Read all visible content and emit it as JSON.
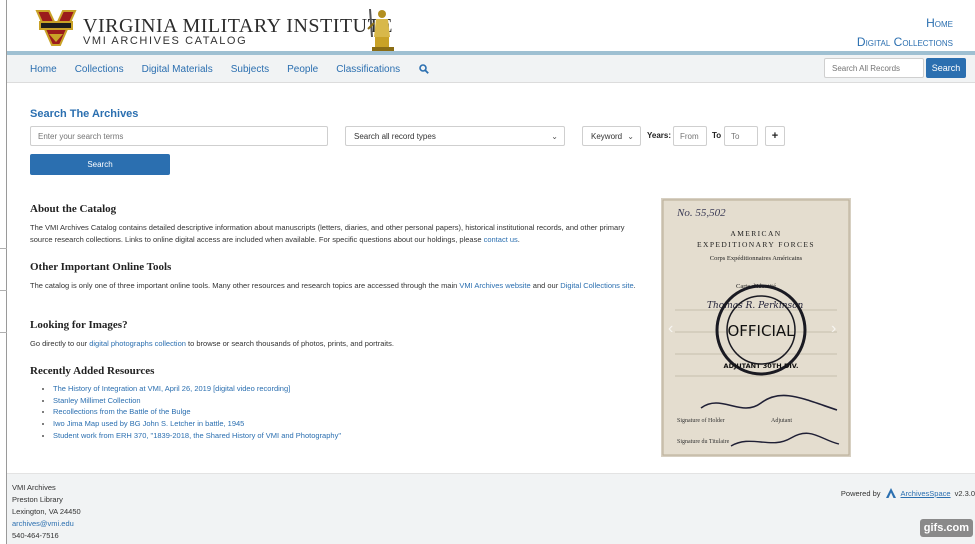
{
  "header": {
    "title": "VIRGINIA MILITARY INSTITUTE",
    "subtitle": "VMI ARCHIVES CATALOG",
    "links": [
      "Home",
      "Digital Collections"
    ],
    "colors": {
      "accent": "#2b6fb0",
      "rule": "#9fc0d2",
      "logo_gold": "#c9a227",
      "logo_red": "#9b1c1c"
    }
  },
  "nav": {
    "items": [
      "Home",
      "Collections",
      "Digital Materials",
      "Subjects",
      "People",
      "Classifications"
    ],
    "search_icon": "magnifier-icon",
    "search_placeholder": "Search All Records",
    "search_button": "Search"
  },
  "search_form": {
    "heading": "Search The Archives",
    "placeholder": "Enter your search terms",
    "record_type": "Search all record types",
    "field": "Keyword",
    "years_label": "Years:",
    "from_placeholder": "From",
    "to_label": "To",
    "to_placeholder": "To",
    "add_row": "+",
    "submit": "Search"
  },
  "about": {
    "heading": "About the Catalog",
    "text": "The VMI Archives Catalog contains detailed descriptive information about manuscripts (letters, diaries, and other personal papers), historical institutional records, and other primary source research collections. Links to online digital access are included when available. For specific questions about our holdings, please ",
    "link": "contact us",
    "tail": "."
  },
  "tools": {
    "heading": "Other Important Online Tools",
    "text": "The catalog is only one of three important online tools. Many other resources and research topics are accessed through the main ",
    "link1": "VMI Archives website",
    "mid": " and our ",
    "link2": "Digital Collections site",
    "tail": "."
  },
  "images": {
    "heading": "Looking for Images?",
    "text": "Go directly to our ",
    "link": "digital photographs collection",
    "tail": " to browse or search thousands of photos, prints, and portraits."
  },
  "recent": {
    "heading": "Recently Added Resources",
    "items": [
      "The History of Integration at VMI, April 26, 2019 [digital video recording]",
      "Stanley Millimet Collection",
      "Recollections from the Battle of the Bulge",
      "Iwo Jima Map used by BG John S. Letcher in battle, 1945",
      "Student work from ERH 370, \"1839-2018, the Shared History of VMI and Photography\""
    ]
  },
  "document_card": {
    "number": "No. 55,502",
    "line1": "AMERICAN",
    "line2": "EXPEDITIONARY FORCES",
    "line3": "Corps Expéditionnaires Américains",
    "line4": "Carte d'Identité",
    "stamp": "OFFICIAL",
    "stamp_ring": "ADJUTANT 30TH DIV.",
    "signature_label": "Signature of Holder",
    "titulaire_label": "Signature du Titulaire",
    "adjutant": "Adjutant",
    "handwritten": "Thomas R. Perkinson"
  },
  "footer": {
    "lines": [
      "VMI Archives",
      "Preston Library",
      "Lexington, VA 24450"
    ],
    "email": "archives@vmi.edu",
    "phone": "540-464-7516",
    "powered_by": "Powered by",
    "product": "ArchivesSpace",
    "version": "v2.3.0"
  },
  "watermark": "gifs.com"
}
